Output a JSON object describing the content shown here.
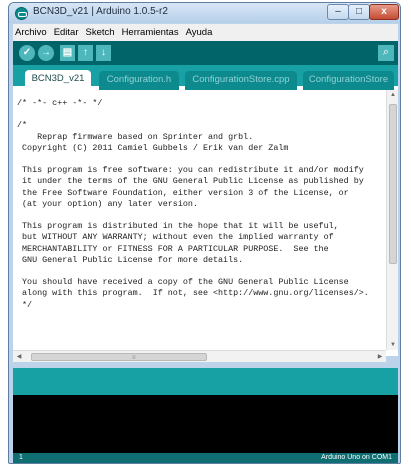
{
  "window": {
    "title": "BCN3D_v21 | Arduino 1.0.5-r2",
    "controls": {
      "minimize": "–",
      "maximize": "□",
      "close": "x"
    }
  },
  "menu": [
    "Archivo",
    "Editar",
    "Sketch",
    "Herramientas",
    "Ayuda"
  ],
  "toolbar": {
    "verify": "✓",
    "upload": "→",
    "new": "▤",
    "open": "↑",
    "save": "↓",
    "serial_monitor": "⌕"
  },
  "tabs": [
    {
      "label": "BCN3D_v21",
      "active": true
    },
    {
      "label": "Configuration.h",
      "active": false
    },
    {
      "label": "ConfigurationStore.cpp",
      "active": false
    },
    {
      "label": "ConfigurationStore",
      "active": false
    }
  ],
  "editor": {
    "code": "/* -*- c++ -*- */\n\n/*\n    Reprap firmware based on Sprinter and grbl.\n Copyright (C) 2011 Camiel Gubbels / Erik van der Zalm\n\n This program is free software: you can redistribute it and/or modify\n it under the terms of the GNU General Public License as published by\n the Free Software Foundation, either version 3 of the License, or\n (at your option) any later version.\n\n This program is distributed in the hope that it will be useful,\n but WITHOUT ANY WARRANTY; without even the implied warranty of\n MERCHANTABILITY or FITNESS FOR A PARTICULAR PURPOSE.  See the\n GNU General Public License for more details.\n\n You should have received a copy of the GNU General Public License\n along with this program.  If not, see <http://www.gnu.org/licenses/>.\n */"
  },
  "status": {
    "line": "1",
    "board": "Arduino Uno on COM1"
  },
  "colors": {
    "toolbar": "#006468",
    "tabbar": "#17a1a5",
    "console": "#000000"
  }
}
